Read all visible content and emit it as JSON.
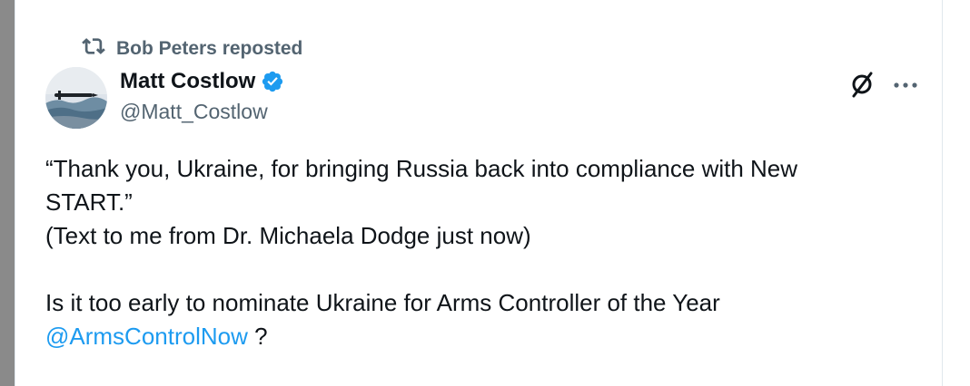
{
  "repost": {
    "label": "Bob Peters reposted"
  },
  "author": {
    "display_name": "Matt Costlow",
    "handle": "@Matt_Costlow",
    "verified": true
  },
  "tweet": {
    "line1": "“Thank you, Ukraine, for bringing Russia back into compliance with New",
    "line2": "START.”",
    "line3": "(Text to me from Dr. Michaela Dodge just now)",
    "line4": "Is it too early to nominate Ukraine for Arms Controller of the Year",
    "mention": "@ArmsControlNow",
    "suffix": " ?"
  },
  "icons": {
    "repost": "repost-icon",
    "verified": "verified-badge-icon",
    "grok": "grok-icon",
    "more": "more-icon"
  },
  "colors": {
    "text_primary": "#0f1419",
    "text_secondary": "#536471",
    "accent": "#1d9bf0"
  }
}
